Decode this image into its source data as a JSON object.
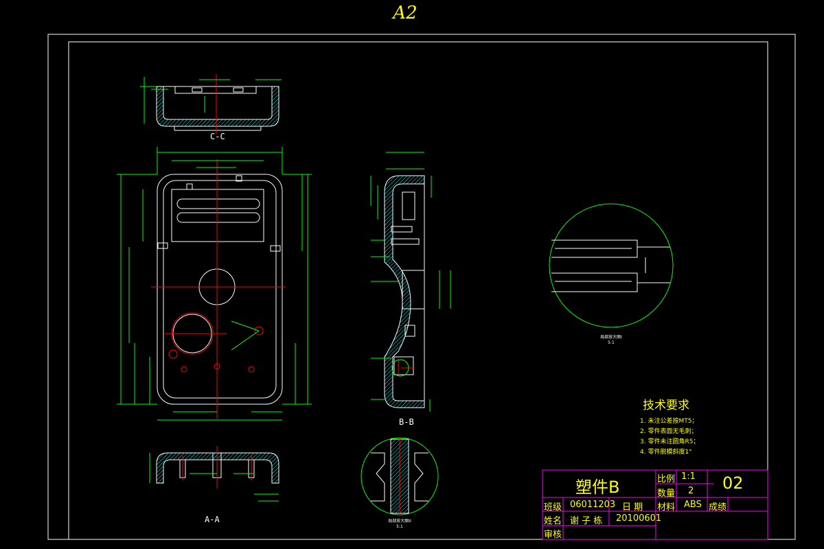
{
  "sheet": {
    "size": "A2"
  },
  "views": {
    "section_cc": "C-C",
    "section_bb": "B-B",
    "section_aa": "A-A",
    "detail_1_caption": "局部放大图I",
    "detail_1_scale": "5:1",
    "detail_2_caption": "局部放大图II",
    "detail_2_scale": "5:1"
  },
  "tech_requirements": {
    "title": "技术要求",
    "items": [
      "1. 未注公差按MT5；",
      "2. 零件表面无毛刺；",
      "3. 零件未注圆角R5；",
      "4. 零件脱模斜度1°"
    ]
  },
  "title_block": {
    "part_name": "塑件B",
    "scale_label": "比例",
    "scale_value": "1:1",
    "qty_label": "数量",
    "qty_value": "2",
    "drawing_no": "02",
    "class_label": "班级",
    "class_value": "06011203",
    "date_label": "日 期",
    "material_label": "材料",
    "material_value": "ABS",
    "grade_label": "成绩",
    "name_label": "姓名",
    "name_value": "谢 子 栋",
    "date_value": "20100601",
    "review_label": "审核"
  },
  "colors": {
    "background": "#000000",
    "outline": "#ffffff",
    "dimension": "#00ff00",
    "centerline": "#ff0000",
    "hatch": "#00ffff",
    "title_block_border": "#ff00ff",
    "text": "#ffff00"
  }
}
